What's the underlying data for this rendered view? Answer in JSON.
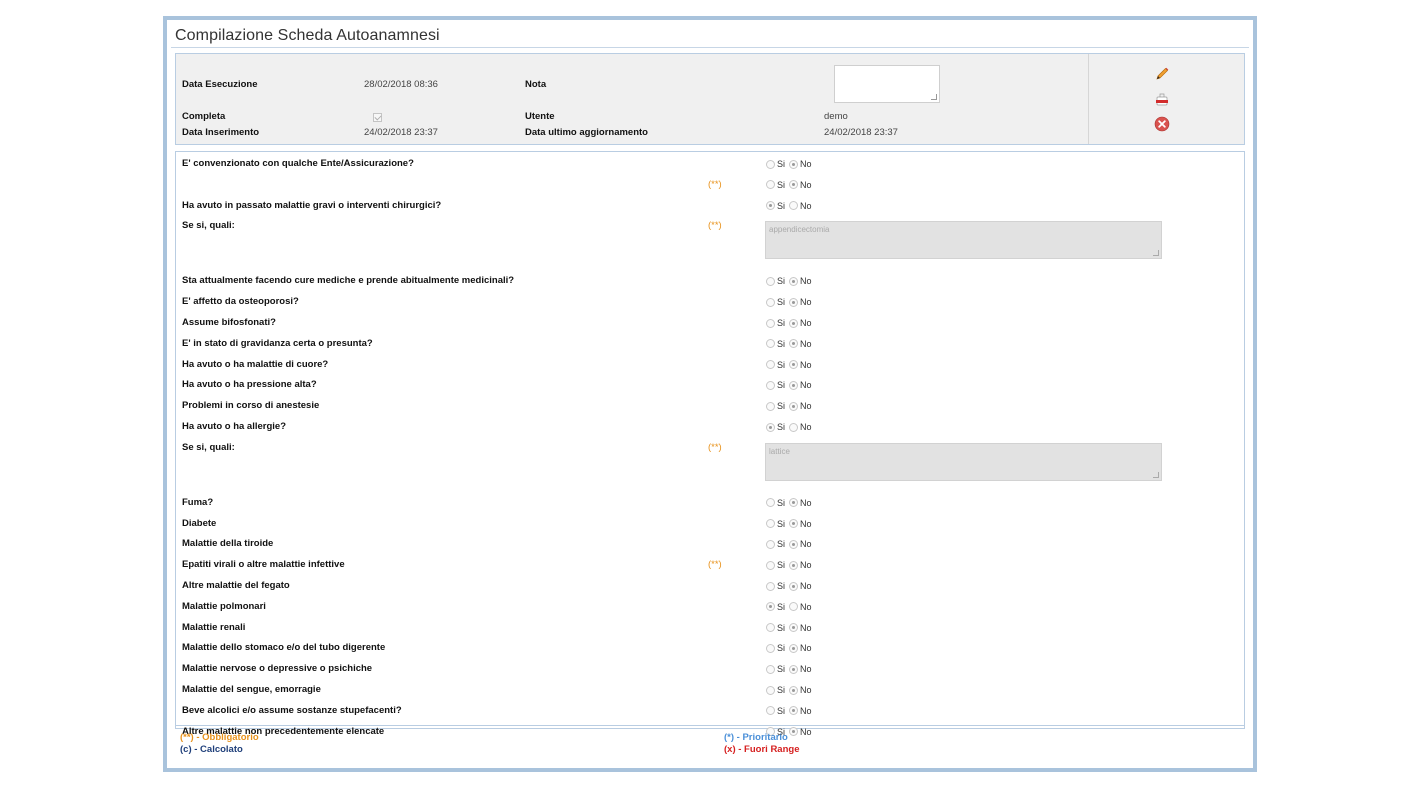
{
  "page": {
    "title": "Compilazione Scheda Autoanamnesi"
  },
  "header": {
    "data_esecuzione_label": "Data Esecuzione",
    "data_esecuzione_value": "28/02/2018 08:36",
    "nota_label": "Nota",
    "nota_value": "",
    "completa_label": "Completa",
    "completa_checked": true,
    "utente_label": "Utente",
    "utente_value": "demo",
    "data_inserimento_label": "Data Inserimento",
    "data_inserimento_value": "24/02/2018 23:37",
    "data_aggiornamento_label": "Data ultimo aggiornamento",
    "data_aggiornamento_value": "24/02/2018 23:37",
    "actions": [
      {
        "icon": "pencil-icon"
      },
      {
        "icon": "pdf-icon"
      },
      {
        "icon": "close-icon",
        "color": "#d9534f"
      }
    ]
  },
  "options": {
    "si": "Si",
    "no": "No"
  },
  "required_mark": "(**)",
  "questions": [
    {
      "label": "E' convenzionato con qualche Ente/Assicurazione?",
      "type": "radio",
      "answer": "No",
      "required": false
    },
    {
      "label": "",
      "type": "radio",
      "answer": "No",
      "required": true
    },
    {
      "label": "Ha avuto in passato malattie gravi o interventi chirurgici?",
      "type": "radio",
      "answer": "Si",
      "required": false
    },
    {
      "label": "Se si, quali:",
      "type": "text",
      "value": "appendicectomia",
      "required": true
    },
    {
      "label": "Sta attualmente facendo cure mediche e prende abitualmente medicinali?",
      "type": "radio",
      "answer": "No",
      "required": false
    },
    {
      "label": "E' affetto da osteoporosi?",
      "type": "radio",
      "answer": "No",
      "required": false
    },
    {
      "label": "Assume bifosfonati?",
      "type": "radio",
      "answer": "No",
      "required": false
    },
    {
      "label": "E' in stato di gravidanza certa o presunta?",
      "type": "radio",
      "answer": "No",
      "required": false
    },
    {
      "label": "Ha avuto o ha malattie di cuore?",
      "type": "radio",
      "answer": "No",
      "required": false
    },
    {
      "label": "Ha avuto o ha pressione alta?",
      "type": "radio",
      "answer": "No",
      "required": false
    },
    {
      "label": "Problemi in corso di anestesie",
      "type": "radio",
      "answer": "No",
      "required": false
    },
    {
      "label": "Ha avuto o ha allergie?",
      "type": "radio",
      "answer": "Si",
      "required": false
    },
    {
      "label": "Se si, quali:",
      "type": "text",
      "value": "lattice",
      "required": true
    },
    {
      "label": "Fuma?",
      "type": "radio",
      "answer": "No",
      "required": false
    },
    {
      "label": "Diabete",
      "type": "radio",
      "answer": "No",
      "required": false
    },
    {
      "label": "Malattie della tiroide",
      "type": "radio",
      "answer": "No",
      "required": false
    },
    {
      "label": "Epatiti virali o altre malattie infettive",
      "type": "radio",
      "answer": "No",
      "required": true
    },
    {
      "label": "Altre malattie del fegato",
      "type": "radio",
      "answer": "No",
      "required": false
    },
    {
      "label": "Malattie polmonari",
      "type": "radio",
      "answer": "Si",
      "required": false
    },
    {
      "label": "Malattie renali",
      "type": "radio",
      "answer": "No",
      "required": false
    },
    {
      "label": "Malattie dello stomaco e/o del tubo digerente",
      "type": "radio",
      "answer": "No",
      "required": false
    },
    {
      "label": "Malattie nervose o depressive o psichiche",
      "type": "radio",
      "answer": "No",
      "required": false
    },
    {
      "label": "Malattie del sengue, emorragie",
      "type": "radio",
      "answer": "No",
      "required": false
    },
    {
      "label": "Beve alcolici e/o assume sostanze stupefacenti?",
      "type": "radio",
      "answer": "No",
      "required": false
    },
    {
      "label": "Altre malattie non precedentemente elencate",
      "type": "radio",
      "answer": "No",
      "required": false
    }
  ],
  "legend": {
    "obbligatorio": {
      "text": "(**) - Obbligatorio",
      "color": "#e8921c"
    },
    "prioritario": {
      "text": "(*) - Prioritario",
      "color": "#4a8fd8"
    },
    "calcolato": {
      "text": "(c) - Calcolato",
      "color": "#1f3f7a"
    },
    "fuori_range": {
      "text": "(x) - Fuori Range",
      "color": "#d62020"
    }
  }
}
